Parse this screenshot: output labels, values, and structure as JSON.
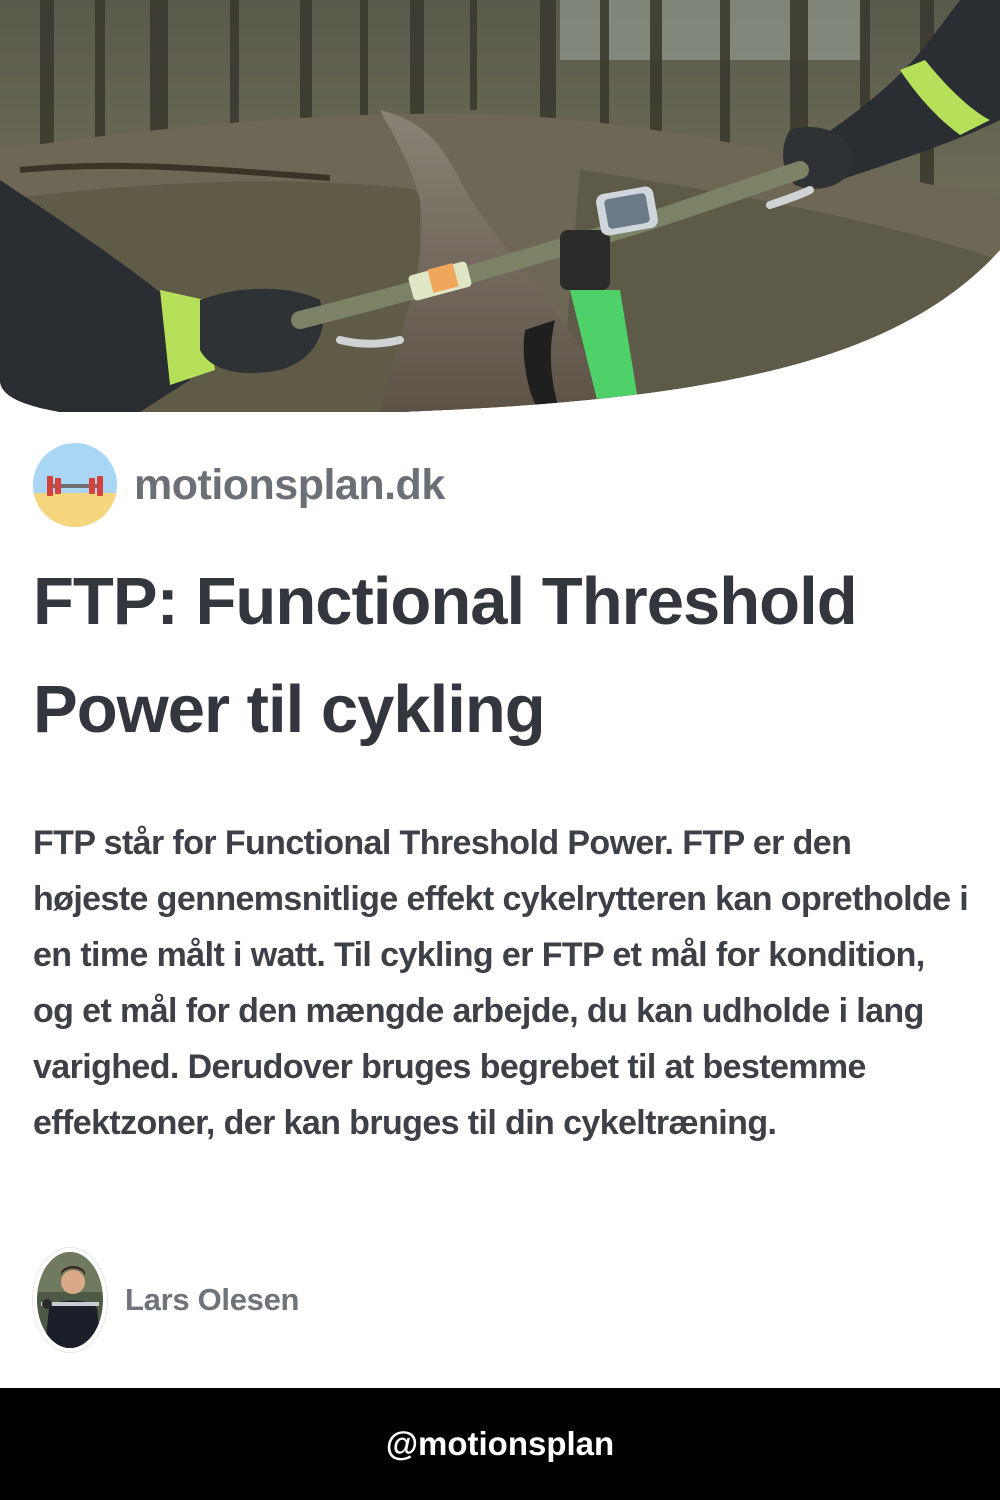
{
  "site": {
    "name": "motionsplan.dk",
    "logo_icon": "dumbbell-beach-icon"
  },
  "article": {
    "title": "FTP: Functional Threshold Power til cykling",
    "excerpt": "FTP står for Functional Threshold Power. FTP er den højeste gennemsnitlige effekt cykelrytteren kan opretholde i en time målt i watt. Til cykling er FTP et mål for kondition, og et mål for den mængde arbejde, du kan udholde i lang varighed. Derudover bruges begrebet til at bestemme effektzoner, der kan bruges til din cykeltræning."
  },
  "author": {
    "name": "Lars Olesen"
  },
  "footer": {
    "handle": "@motionsplan"
  },
  "colors": {
    "bike_frame": "#4fd16a",
    "glove_accent": "#b7e05a",
    "trail": "#6d5f52"
  }
}
